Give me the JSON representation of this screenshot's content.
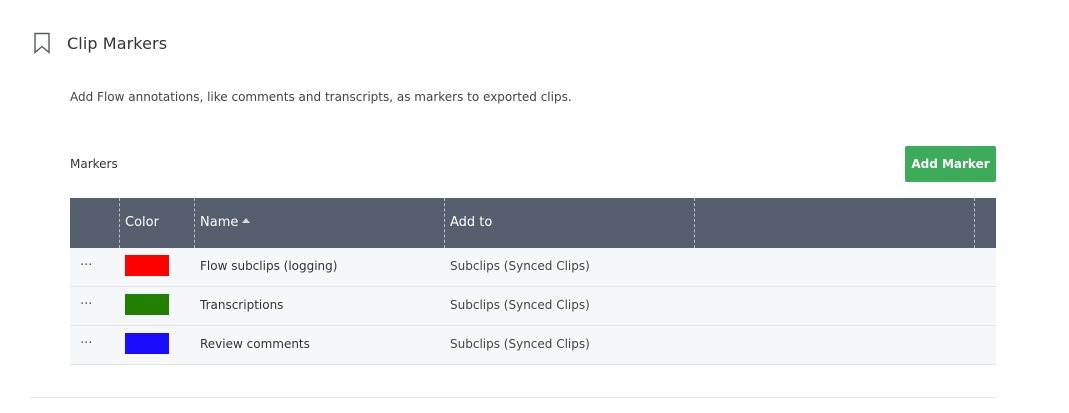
{
  "section": {
    "title": "Clip Markers",
    "icon": "bookmark-icon",
    "description": "Add Flow annotations, like comments and transcripts, as markers to exported clips."
  },
  "markers": {
    "label": "Markers",
    "add_button_label": "Add Marker",
    "add_button_color": "#3cac5a"
  },
  "table": {
    "header_color": "#565f6d",
    "columns": {
      "color": "Color",
      "name": "Name",
      "add_to": "Add to"
    },
    "sort": {
      "column": "name",
      "direction": "ascending"
    },
    "rows": [
      {
        "menu": "···",
        "color": "#ff0000",
        "name": "Flow subclips (logging)",
        "add_to": "Subclips (Synced Clips)"
      },
      {
        "menu": "···",
        "color": "#228000",
        "name": "Transcriptions",
        "add_to": "Subclips (Synced Clips)"
      },
      {
        "menu": "···",
        "color": "#1a0dff",
        "name": "Review comments",
        "add_to": "Subclips (Synced Clips)"
      }
    ]
  }
}
